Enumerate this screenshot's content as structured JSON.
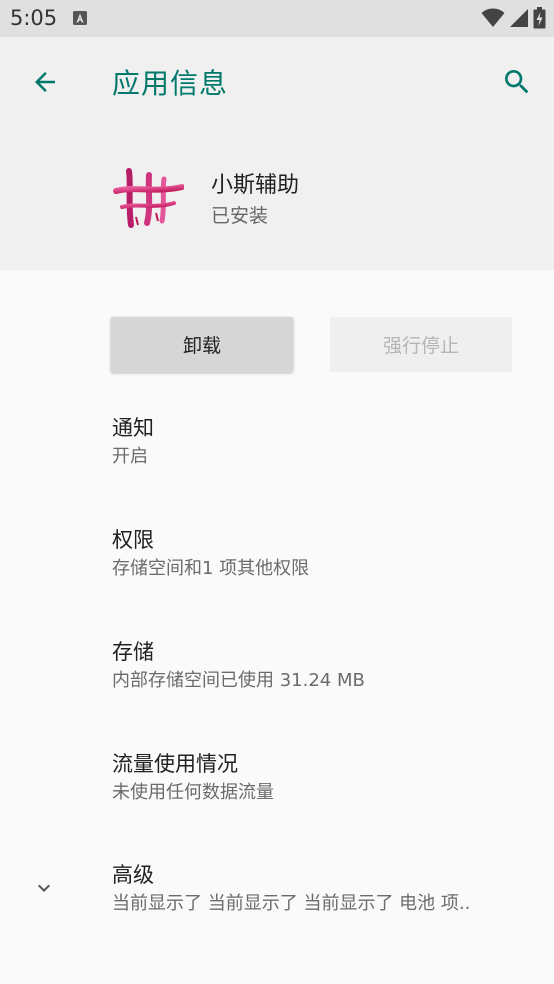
{
  "status_bar": {
    "time": "5:05",
    "notification_icon": "a-badge-icon",
    "wifi_icon": "wifi-icon",
    "signal_icon": "signal-icon",
    "battery_icon": "battery-icon"
  },
  "toolbar": {
    "title": "应用信息",
    "back_icon": "arrow-back-icon",
    "search_icon": "search-icon",
    "accent_color": "#00796b"
  },
  "app": {
    "name": "小斯辅助",
    "status": "已安装",
    "icon": "app-logo-icon"
  },
  "buttons": {
    "uninstall": "卸载",
    "force_stop": "强行停止"
  },
  "preferences": [
    {
      "title": "通知",
      "summary": "开启"
    },
    {
      "title": "权限",
      "summary": "存储空间和1 项其他权限"
    },
    {
      "title": "存储",
      "summary": "内部存储空间已使用 31.24 MB"
    },
    {
      "title": "流量使用情况",
      "summary": "未使用任何数据流量"
    },
    {
      "title": "高级",
      "summary": "当前显示了 当前显示了 当前显示了 电池 项..",
      "icon": "chevron-down-icon"
    }
  ]
}
